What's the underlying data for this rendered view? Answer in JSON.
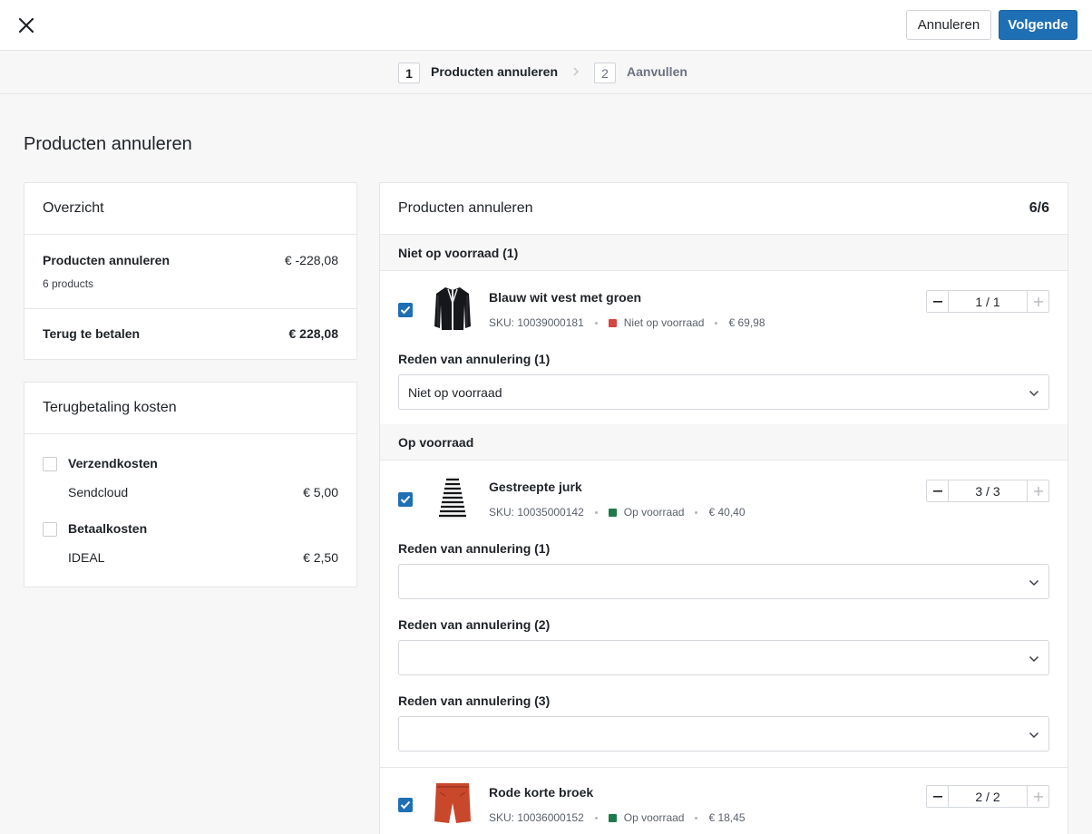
{
  "header": {
    "cancel_label": "Annuleren",
    "next_label": "Volgende"
  },
  "steps": [
    {
      "num": "1",
      "label": "Producten annuleren"
    },
    {
      "num": "2",
      "label": "Aanvullen"
    }
  ],
  "page_title": "Producten annuleren",
  "overview": {
    "title": "Overzicht",
    "cancel_label": "Producten annuleren",
    "cancel_amount": "€ -228,08",
    "product_count": "6 products",
    "refund_label": "Terug te betalen",
    "refund_amount": "€ 228,08"
  },
  "costs": {
    "title": "Terugbetaling kosten",
    "shipping_label": "Verzendkosten",
    "shipping_provider": "Sendcloud",
    "shipping_amount": "€ 5,00",
    "payment_label": "Betaalkosten",
    "payment_provider": "IDEAL",
    "payment_amount": "€ 2,50"
  },
  "products_card": {
    "title": "Producten annuleren",
    "count": "6/6",
    "group_out_of_stock": "Niet op voorraad (1)",
    "group_in_stock": "Op voorraad"
  },
  "products": [
    {
      "name": "Blauw wit vest met groen",
      "sku": "SKU: 10039000181",
      "stock": "Niet op voorraad",
      "stock_color": "#d64541",
      "price": "€ 69,98",
      "qty": "1 / 1",
      "reasons": [
        {
          "label": "Reden van annulering (1)",
          "value": "Niet op voorraad"
        }
      ]
    },
    {
      "name": "Gestreepte jurk",
      "sku": "SKU: 10035000142",
      "stock": "Op voorraad",
      "stock_color": "#1e7a4c",
      "price": "€ 40,40",
      "qty": "3 / 3",
      "reasons": [
        {
          "label": "Reden van annulering (1)",
          "value": ""
        },
        {
          "label": "Reden van annulering (2)",
          "value": ""
        },
        {
          "label": "Reden van annulering (3)",
          "value": ""
        }
      ]
    },
    {
      "name": "Rode korte broek",
      "sku": "SKU: 10036000152",
      "stock": "Op voorraad",
      "stock_color": "#1e7a4c",
      "price": "€ 18,45",
      "qty": "2 / 2",
      "reasons": []
    }
  ]
}
